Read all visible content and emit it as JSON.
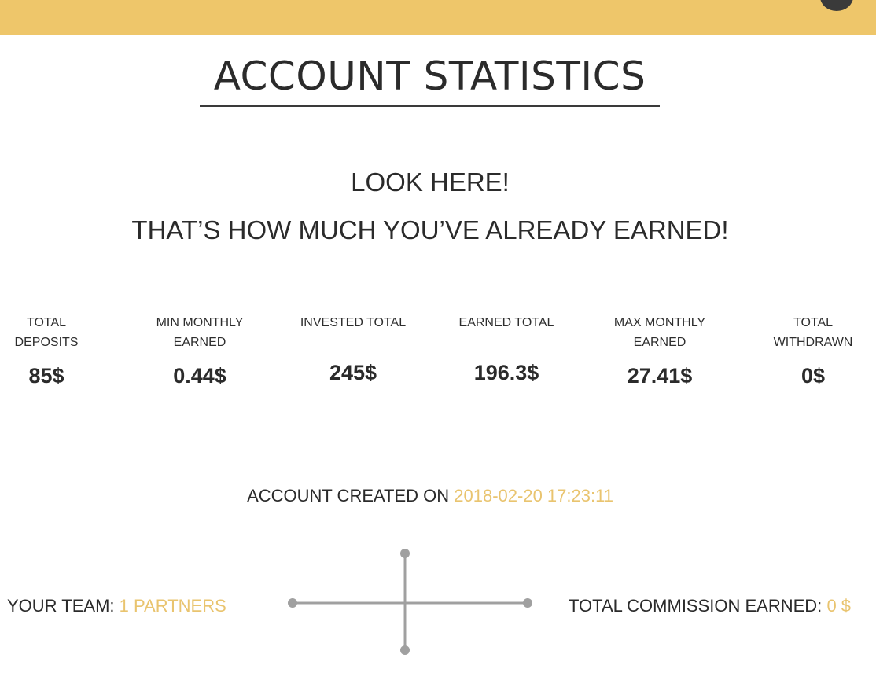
{
  "header": {
    "bar_color": "#eec66a",
    "avatar_icon": "user-avatar-icon"
  },
  "page": {
    "title": "ACCOUNT STATISTICS",
    "headline_line1": "LOOK HERE!",
    "headline_line2": "THAT’S HOW MUCH YOU’VE ALREADY EARNED!"
  },
  "stats": [
    {
      "label_line1": "TOTAL",
      "label_line2": "DEPOSITS",
      "value": "85$"
    },
    {
      "label_line1": "MIN MONTHLY",
      "label_line2": "EARNED",
      "value": "0.44$"
    },
    {
      "label_line1": "INVESTED TOTAL",
      "label_line2": "",
      "value": "245$"
    },
    {
      "label_line1": "EARNED TOTAL",
      "label_line2": "",
      "value": "196.3$"
    },
    {
      "label_line1": "MAX MONTHLY",
      "label_line2": "EARNED",
      "value": "27.41$"
    },
    {
      "label_line1": "TOTAL",
      "label_line2": "WITHDRAWN",
      "value": "0$"
    }
  ],
  "account": {
    "created_label": "ACCOUNT CREATED ON",
    "created_value": "2018-02-20 17:23:11"
  },
  "team": {
    "label": "YOUR TEAM:",
    "value": "1 PARTNERS"
  },
  "commission": {
    "label": "TOTAL COMMISSION EARNED:",
    "value": "0 $"
  },
  "colors": {
    "accent": "#e9c46f",
    "text": "#2b2b2b",
    "connector": "#a0a0a0"
  }
}
